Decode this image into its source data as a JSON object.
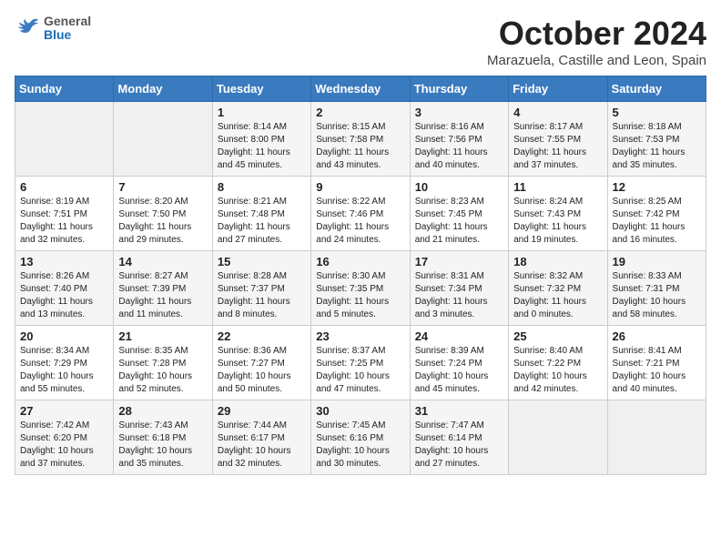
{
  "logo": {
    "general": "General",
    "blue": "Blue"
  },
  "title": "October 2024",
  "subtitle": "Marazuela, Castille and Leon, Spain",
  "weekdays": [
    "Sunday",
    "Monday",
    "Tuesday",
    "Wednesday",
    "Thursday",
    "Friday",
    "Saturday"
  ],
  "weeks": [
    [
      {
        "day": "",
        "info": ""
      },
      {
        "day": "",
        "info": ""
      },
      {
        "day": "1",
        "info": "Sunrise: 8:14 AM\nSunset: 8:00 PM\nDaylight: 11 hours and 45 minutes."
      },
      {
        "day": "2",
        "info": "Sunrise: 8:15 AM\nSunset: 7:58 PM\nDaylight: 11 hours and 43 minutes."
      },
      {
        "day": "3",
        "info": "Sunrise: 8:16 AM\nSunset: 7:56 PM\nDaylight: 11 hours and 40 minutes."
      },
      {
        "day": "4",
        "info": "Sunrise: 8:17 AM\nSunset: 7:55 PM\nDaylight: 11 hours and 37 minutes."
      },
      {
        "day": "5",
        "info": "Sunrise: 8:18 AM\nSunset: 7:53 PM\nDaylight: 11 hours and 35 minutes."
      }
    ],
    [
      {
        "day": "6",
        "info": "Sunrise: 8:19 AM\nSunset: 7:51 PM\nDaylight: 11 hours and 32 minutes."
      },
      {
        "day": "7",
        "info": "Sunrise: 8:20 AM\nSunset: 7:50 PM\nDaylight: 11 hours and 29 minutes."
      },
      {
        "day": "8",
        "info": "Sunrise: 8:21 AM\nSunset: 7:48 PM\nDaylight: 11 hours and 27 minutes."
      },
      {
        "day": "9",
        "info": "Sunrise: 8:22 AM\nSunset: 7:46 PM\nDaylight: 11 hours and 24 minutes."
      },
      {
        "day": "10",
        "info": "Sunrise: 8:23 AM\nSunset: 7:45 PM\nDaylight: 11 hours and 21 minutes."
      },
      {
        "day": "11",
        "info": "Sunrise: 8:24 AM\nSunset: 7:43 PM\nDaylight: 11 hours and 19 minutes."
      },
      {
        "day": "12",
        "info": "Sunrise: 8:25 AM\nSunset: 7:42 PM\nDaylight: 11 hours and 16 minutes."
      }
    ],
    [
      {
        "day": "13",
        "info": "Sunrise: 8:26 AM\nSunset: 7:40 PM\nDaylight: 11 hours and 13 minutes."
      },
      {
        "day": "14",
        "info": "Sunrise: 8:27 AM\nSunset: 7:39 PM\nDaylight: 11 hours and 11 minutes."
      },
      {
        "day": "15",
        "info": "Sunrise: 8:28 AM\nSunset: 7:37 PM\nDaylight: 11 hours and 8 minutes."
      },
      {
        "day": "16",
        "info": "Sunrise: 8:30 AM\nSunset: 7:35 PM\nDaylight: 11 hours and 5 minutes."
      },
      {
        "day": "17",
        "info": "Sunrise: 8:31 AM\nSunset: 7:34 PM\nDaylight: 11 hours and 3 minutes."
      },
      {
        "day": "18",
        "info": "Sunrise: 8:32 AM\nSunset: 7:32 PM\nDaylight: 11 hours and 0 minutes."
      },
      {
        "day": "19",
        "info": "Sunrise: 8:33 AM\nSunset: 7:31 PM\nDaylight: 10 hours and 58 minutes."
      }
    ],
    [
      {
        "day": "20",
        "info": "Sunrise: 8:34 AM\nSunset: 7:29 PM\nDaylight: 10 hours and 55 minutes."
      },
      {
        "day": "21",
        "info": "Sunrise: 8:35 AM\nSunset: 7:28 PM\nDaylight: 10 hours and 52 minutes."
      },
      {
        "day": "22",
        "info": "Sunrise: 8:36 AM\nSunset: 7:27 PM\nDaylight: 10 hours and 50 minutes."
      },
      {
        "day": "23",
        "info": "Sunrise: 8:37 AM\nSunset: 7:25 PM\nDaylight: 10 hours and 47 minutes."
      },
      {
        "day": "24",
        "info": "Sunrise: 8:39 AM\nSunset: 7:24 PM\nDaylight: 10 hours and 45 minutes."
      },
      {
        "day": "25",
        "info": "Sunrise: 8:40 AM\nSunset: 7:22 PM\nDaylight: 10 hours and 42 minutes."
      },
      {
        "day": "26",
        "info": "Sunrise: 8:41 AM\nSunset: 7:21 PM\nDaylight: 10 hours and 40 minutes."
      }
    ],
    [
      {
        "day": "27",
        "info": "Sunrise: 7:42 AM\nSunset: 6:20 PM\nDaylight: 10 hours and 37 minutes."
      },
      {
        "day": "28",
        "info": "Sunrise: 7:43 AM\nSunset: 6:18 PM\nDaylight: 10 hours and 35 minutes."
      },
      {
        "day": "29",
        "info": "Sunrise: 7:44 AM\nSunset: 6:17 PM\nDaylight: 10 hours and 32 minutes."
      },
      {
        "day": "30",
        "info": "Sunrise: 7:45 AM\nSunset: 6:16 PM\nDaylight: 10 hours and 30 minutes."
      },
      {
        "day": "31",
        "info": "Sunrise: 7:47 AM\nSunset: 6:14 PM\nDaylight: 10 hours and 27 minutes."
      },
      {
        "day": "",
        "info": ""
      },
      {
        "day": "",
        "info": ""
      }
    ]
  ]
}
